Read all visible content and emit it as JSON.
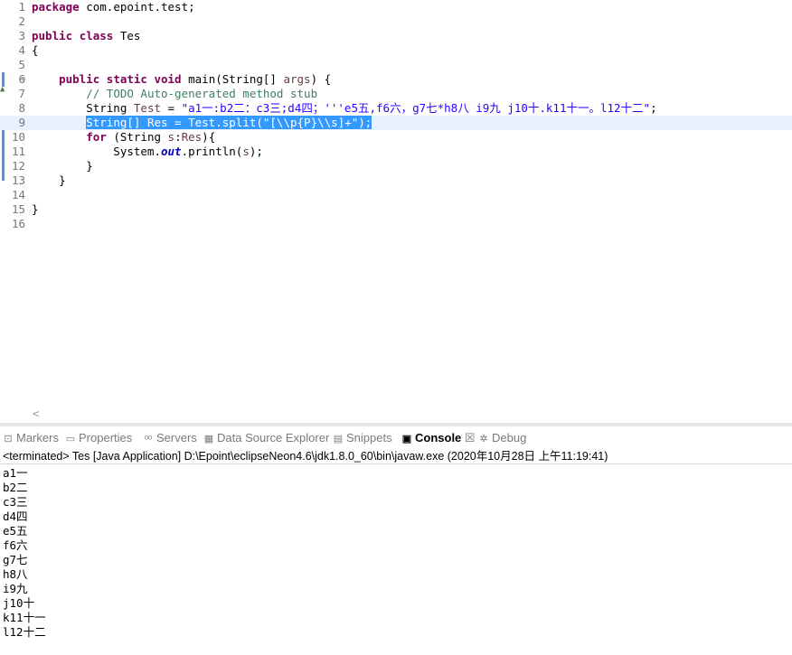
{
  "editor": {
    "lines": [
      {
        "n": "1",
        "html": "<span class=\"kw\">package</span> com.epoint.test;"
      },
      {
        "n": "2",
        "html": ""
      },
      {
        "n": "3",
        "html": "<span class=\"kw\">public</span> <span class=\"kw\">class</span> Tes"
      },
      {
        "n": "4",
        "html": "{"
      },
      {
        "n": "5",
        "html": ""
      },
      {
        "n": "6",
        "html": "    <span class=\"kw\">public</span> <span class=\"kw\">static</span> <span class=\"kw\">void</span> main(String[] <span class=\"par\">args</span>) {"
      },
      {
        "n": "7",
        "html": "        <span class=\"cm\">// TODO Auto-generated method stub</span>"
      },
      {
        "n": "8",
        "html": "        String <span class=\"par\">Test</span> = <span class=\"str\">\"a1一:b2二：c3三;d4四；'''e5五,f6六，g7七*h8八 i9九 j10十.k11十一。l12十二\"</span>;"
      },
      {
        "n": "9",
        "html": "        <span class=\"sel\">String[] Res = Test.split(\"[\\\\p{P}\\\\s]+\");</span>"
      },
      {
        "n": "10",
        "html": "        <span class=\"kw\">for</span> (String <span class=\"par\">s</span>:<span class=\"par\">Res</span>){"
      },
      {
        "n": "11",
        "html": "            System.<span class=\"fld\">out</span>.println(<span class=\"par\">s</span>);"
      },
      {
        "n": "12",
        "html": "        }"
      },
      {
        "n": "13",
        "html": "    }"
      },
      {
        "n": "14",
        "html": ""
      },
      {
        "n": "15",
        "html": "}"
      },
      {
        "n": "16",
        "html": ""
      }
    ],
    "fold_glyph": "⊖",
    "scroll_left": "<"
  },
  "tabs": [
    {
      "label": "Markers",
      "icon": "⊡",
      "active": false
    },
    {
      "label": "Properties",
      "icon": "▭",
      "active": false
    },
    {
      "label": "Servers",
      "icon": "ᵒᵒ",
      "active": false
    },
    {
      "label": "Data Source Explorer",
      "icon": "▦",
      "active": false
    },
    {
      "label": "Snippets",
      "icon": "▤",
      "active": false
    },
    {
      "label": "Console",
      "icon": "▣",
      "active": true,
      "close": "☒"
    },
    {
      "label": "Debug",
      "icon": "✲",
      "active": false
    }
  ],
  "console": {
    "status": "<terminated> Tes [Java Application] D:\\Epoint\\eclipseNeon4.6\\jdk1.8.0_60\\bin\\javaw.exe (2020年10月28日 上午11:19:41)",
    "output": [
      "a1一",
      "b2二",
      "c3三",
      "d4四",
      "e5五",
      "f6六",
      "g7七",
      "h8八",
      "i9九",
      "j10十",
      "k11十一",
      "l12十二"
    ]
  },
  "colors": {
    "keyword": "#7f0055",
    "comment": "#3f7f5f",
    "string": "#2a00ff",
    "selection": "#3399ff",
    "current_line": "#e8f2fe"
  }
}
